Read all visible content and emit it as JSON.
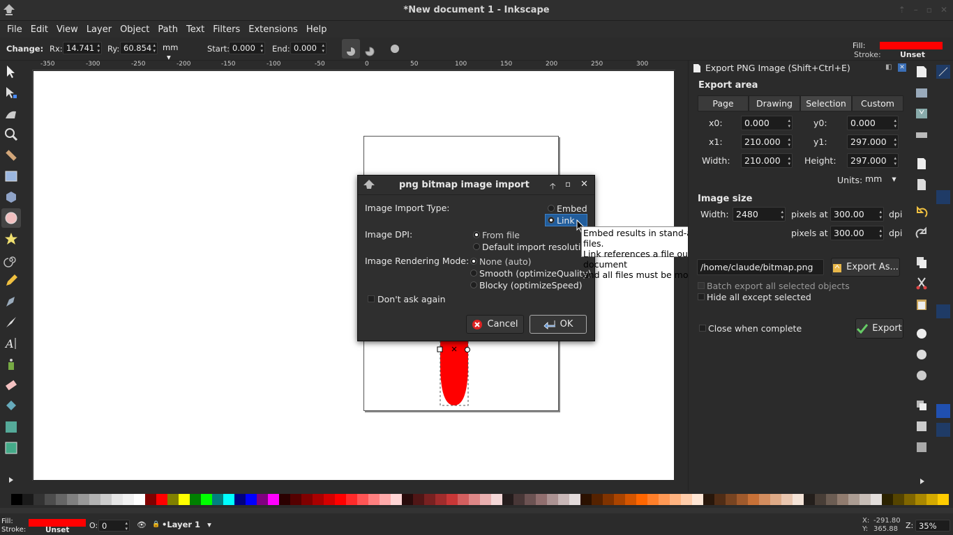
{
  "window": {
    "title": "*New document 1 - Inkscape"
  },
  "menu": [
    "File",
    "Edit",
    "View",
    "Layer",
    "Object",
    "Path",
    "Text",
    "Filters",
    "Extensions",
    "Help"
  ],
  "toolctrl": {
    "change_label": "Change:",
    "rx_label": "Rx:",
    "rx_value": "14.741",
    "ry_label": "Ry:",
    "ry_value": "60.854",
    "unit": "mm",
    "start_label": "Start:",
    "start_value": "0.000",
    "end_label": "End:",
    "end_value": "0.000"
  },
  "style_indicator": {
    "fill_label": "Fill:",
    "stroke_label": "Stroke:",
    "stroke_value": "Unset",
    "fill_color": "#ff0000"
  },
  "ruler": {
    "h_ticks": [
      "-350",
      "-300",
      "-250",
      "-200",
      "-150",
      "-100",
      "-50",
      "0",
      "50",
      "100",
      "150",
      "200",
      "250",
      "300"
    ]
  },
  "dialog": {
    "title": "png bitmap image import",
    "import_type_label": "Image Import Type:",
    "embed_label": "Embed",
    "link_label": "Link",
    "dpi_label": "Image DPI:",
    "dpi_from_file": "From file",
    "dpi_default": "Default import resolutio",
    "render_label": "Image Rendering Mode:",
    "render_none": "None (auto)",
    "render_smooth": "Smooth (optimizeQuality)",
    "render_blocky": "Blocky (optimizeSpeed)",
    "dont_ask": "Don't ask again",
    "cancel": "Cancel",
    "ok": "OK"
  },
  "tooltip": {
    "line1": "Embed results in stand-alone, larger SVG files.",
    "line2": "Link references a file outside this SVG document",
    "line3": "and all files must be moved together."
  },
  "export": {
    "header": "Export PNG Image (Shift+Ctrl+E)",
    "area_title": "Export area",
    "tabs": [
      "Page",
      "Drawing",
      "Selection",
      "Custom"
    ],
    "x0_label": "x0:",
    "x0": "0.000",
    "y0_label": "y0:",
    "y0": "0.000",
    "x1_label": "x1:",
    "x1": "210.000",
    "y1_label": "y1:",
    "y1": "297.000",
    "width_label": "Width:",
    "width": "210.000",
    "height_label": "Height:",
    "height": "297.000",
    "units_label": "Units:",
    "units": "mm",
    "size_title": "Image size",
    "img_width_label": "Width:",
    "img_width": "2480",
    "pixels_at": "pixels at",
    "dpi1": "300.00",
    "dpi2": "300.00",
    "dpi_unit": "dpi",
    "filename": "/home/claude/bitmap.png",
    "export_as": "Export As...",
    "batch": "Batch export all selected objects",
    "hide": "Hide all except selected",
    "close_when": "Close when complete",
    "export_btn": "Export"
  },
  "status": {
    "fill_label": "Fill:",
    "stroke_label": "Stroke:",
    "stroke_value": "Unset",
    "opacity_label": "O:",
    "opacity": "0",
    "layer": "•Layer 1",
    "x_label": "X:",
    "x": "-291.80",
    "y_label": "Y:",
    "y": "365.88",
    "z_label": "Z:",
    "zoom": "35%"
  },
  "palette": [
    "#000000",
    "#1a1a1a",
    "#333333",
    "#4d4d4d",
    "#666666",
    "#808080",
    "#999999",
    "#b3b3b3",
    "#cccccc",
    "#e6e6e6",
    "#f2f2f2",
    "#ffffff",
    "#800000",
    "#ff0000",
    "#808000",
    "#ffff00",
    "#008000",
    "#00ff00",
    "#008080",
    "#00ffff",
    "#000080",
    "#0000ff",
    "#800080",
    "#ff00ff",
    "#2b0000",
    "#550000",
    "#800000",
    "#aa0000",
    "#d40000",
    "#ff0000",
    "#ff2a2a",
    "#ff5555",
    "#ff8080",
    "#ffaaaa",
    "#ffd5d5",
    "#280b0b",
    "#501616",
    "#782121",
    "#a02c2c",
    "#c83737",
    "#d35f5f",
    "#de8787",
    "#e9afaf",
    "#f4d7d7",
    "#241c1c",
    "#483737",
    "#6c5353",
    "#916f6f",
    "#ac9393",
    "#c8b7b7",
    "#e3dbdb",
    "#2b1100",
    "#552200",
    "#803300",
    "#aa4400",
    "#d45500",
    "#ff6600",
    "#ff7f2a",
    "#ff9955",
    "#ffb380",
    "#ffccaa",
    "#ffe6d5",
    "#28170b",
    "#502d16",
    "#784421",
    "#a05a2c",
    "#c87137",
    "#d38d5f",
    "#deaa87",
    "#e9c6af",
    "#f4e3d7",
    "#241f1c",
    "#483e37",
    "#6c5d53",
    "#917c6f",
    "#ac9d93",
    "#c8beb7",
    "#e3dedb",
    "#2b2200",
    "#554400",
    "#806600",
    "#aa8800",
    "#d4aa00",
    "#ffcc00"
  ]
}
